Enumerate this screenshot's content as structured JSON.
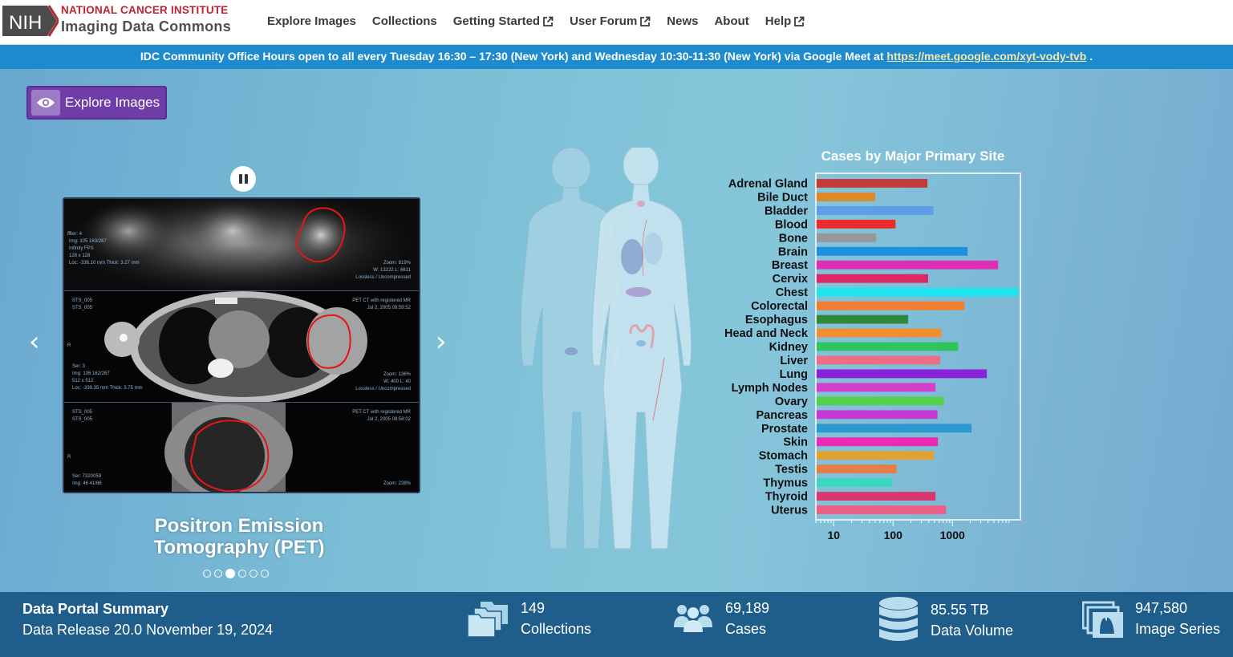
{
  "header": {
    "logo_text": "NIH",
    "institute": "NATIONAL CANCER INSTITUTE",
    "product": "Imaging Data Commons",
    "nav": [
      {
        "label": "Explore Images",
        "external": false
      },
      {
        "label": "Collections",
        "external": false
      },
      {
        "label": "Getting Started",
        "external": true
      },
      {
        "label": "User Forum",
        "external": true
      },
      {
        "label": "News",
        "external": false
      },
      {
        "label": "About",
        "external": false
      },
      {
        "label": "Help",
        "external": true
      }
    ]
  },
  "banner": {
    "text": "IDC Community Office Hours open to all every Tuesday 16:30 – 17:30 (New York) and Wednesday 10:30-11:30 (New York) via Google Meet at ",
    "link": "https://meet.google.com/xyt-vody-tvb",
    "suffix": " ."
  },
  "hero": {
    "explore_label": "Explore Images",
    "carousel": {
      "caption": "Positron Emission Tomography (PET)",
      "slide_count": 6,
      "active_index": 2,
      "panels": [
        {
          "left": "Ser: 4\nImg: 105 163/267\nInfinity FPS\n128 x 128\nLoc: -336.10 mm Thick: 3.27 mm",
          "right": "Zoom: 819%\nW: 13222 L: 6611\nLossless / Uncompressed",
          "top_left": "",
          "top_right": "",
          "side": "R"
        },
        {
          "left": "Ser: 3\nImg: 106 162/267\n512 x 512\nLoc: -339.35 mm Thick: 3.75 mm",
          "right": "Zoom: 136%\nW: 400 L: 40\nLossless / Uncompressed",
          "top_left": "STS_005\nSTS_005",
          "top_right": "PET CT with registered MR\nJul 2, 2005 09:59:52",
          "side": "R"
        },
        {
          "left": "Ser: 7320059\nImg: 46 41/86",
          "right": "Zoom: 238%",
          "top_left": "STS_005\nSTS_005",
          "top_right": "PET CT with registered MR\nJul 2, 2005 08:58:02",
          "side": "R"
        }
      ]
    }
  },
  "chart_data": {
    "type": "bar",
    "title": "Cases by Major Primary Site",
    "xscale": "log",
    "xlim": [
      5,
      14000
    ],
    "xticks": [
      10,
      100,
      1000
    ],
    "xtick_labels": [
      "10",
      "100",
      "1000"
    ],
    "categories": [
      "Adrenal Gland",
      "Bile Duct",
      "Bladder",
      "Blood",
      "Bone",
      "Brain",
      "Breast",
      "Cervix",
      "Chest",
      "Colorectal",
      "Esophagus",
      "Head and Neck",
      "Kidney",
      "Liver",
      "Lung",
      "Lymph Nodes",
      "Ovary",
      "Pancreas",
      "Prostate",
      "Skin",
      "Stomach",
      "Testis",
      "Thymus",
      "Thyroid",
      "Uterus"
    ],
    "values": [
      380,
      50,
      480,
      110,
      52,
      1800,
      5900,
      390,
      13000,
      1600,
      180,
      650,
      1250,
      620,
      3800,
      520,
      720,
      560,
      2100,
      570,
      490,
      115,
      96,
      520,
      780
    ],
    "colors": [
      "#c73a3a",
      "#dc8a28",
      "#5e9ee8",
      "#ef2a2a",
      "#979797",
      "#1e90e0",
      "#dd2fb3",
      "#dc2864",
      "#1ee4ef",
      "#f07e32",
      "#2e8a3a",
      "#f08e30",
      "#2fc45e",
      "#ec6e86",
      "#8a22d8",
      "#d33ecc",
      "#52d24e",
      "#c33ad4",
      "#2c9ad0",
      "#e82ab6",
      "#e2a232",
      "#e47e46",
      "#3cd6c2",
      "#d9386e",
      "#f05e86"
    ]
  },
  "footer": {
    "title": "Data Portal Summary",
    "release": "Data Release 20.0 November 19, 2024",
    "stats": [
      {
        "icon": "folders-icon",
        "value": "149",
        "label": "Collections"
      },
      {
        "icon": "people-icon",
        "value": "69,189",
        "label": "Cases"
      },
      {
        "icon": "database-icon",
        "value": "85.55 TB",
        "label": "Data Volume"
      },
      {
        "icon": "image-series-icon",
        "value": "947,580",
        "label": "Image Series"
      }
    ]
  }
}
